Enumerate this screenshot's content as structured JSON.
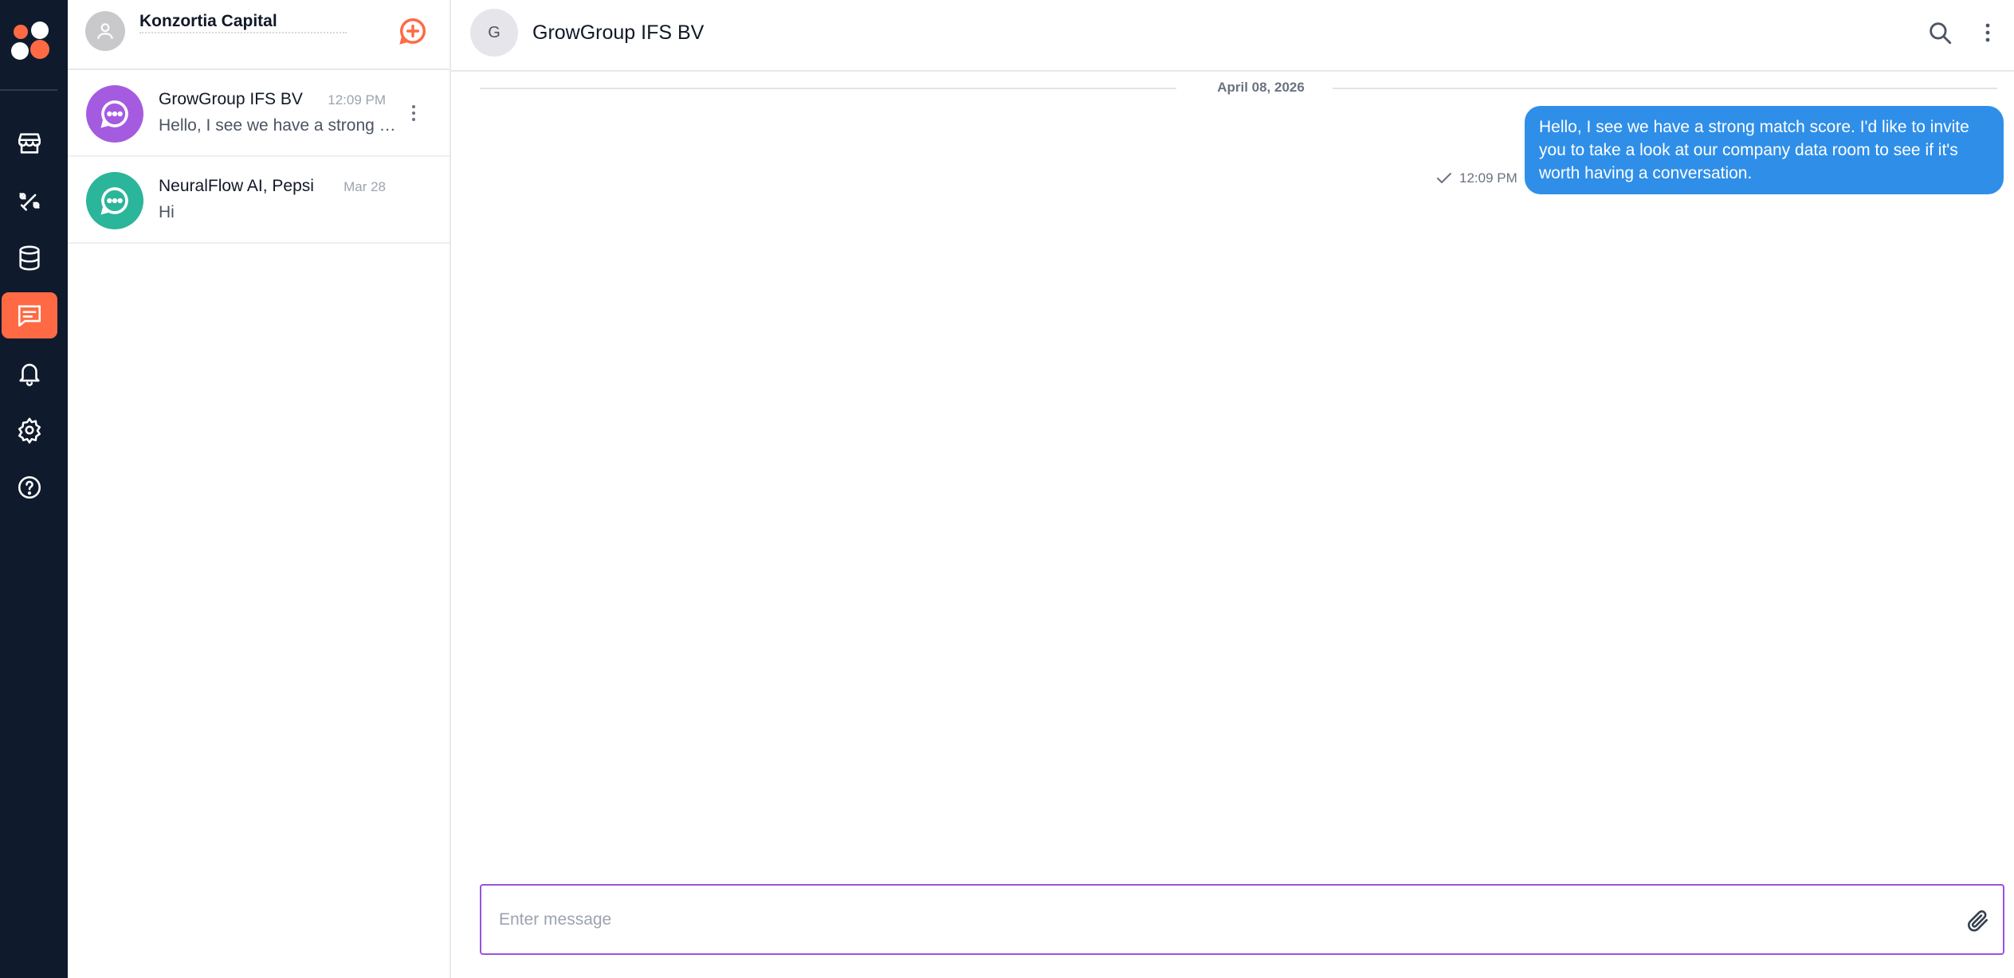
{
  "brand": {
    "accent": "#ff6a44",
    "rail_bg": "#0f1b2d",
    "bubble_color": "#2f8fe8"
  },
  "rail": {
    "items": [
      {
        "icon": "storefront-icon",
        "active": false
      },
      {
        "icon": "handshake-icon",
        "active": false
      },
      {
        "icon": "database-icon",
        "active": false
      },
      {
        "icon": "chat-icon",
        "active": true
      },
      {
        "icon": "bell-icon",
        "active": false
      },
      {
        "icon": "gear-icon",
        "active": false
      },
      {
        "icon": "help-icon",
        "active": false
      }
    ]
  },
  "account": {
    "name": "Konzortia Capital"
  },
  "conversations": [
    {
      "name": "GrowGroup IFS BV",
      "time": "12:09 PM",
      "preview": "Hello, I see we have a strong match score. I'd like to invite you to take a look at our company data room to see if it's worth having a conversation.",
      "avatar_color": "#a55be0"
    },
    {
      "name": "NeuralFlow AI, Pepsi",
      "time": "Mar 28",
      "preview": "Hi",
      "avatar_color": "#2bb59a"
    }
  ],
  "chat": {
    "avatar_letter": "G",
    "title": "GrowGroup IFS BV",
    "date_separator": "April 08, 2026",
    "messages": [
      {
        "text": "Hello, I see we have a strong match score. I'd like to invite you to take a look at our company data room to see if it's worth having a conversation.",
        "time": "12:09 PM",
        "status": "sent"
      }
    ],
    "composer_placeholder": "Enter message"
  }
}
